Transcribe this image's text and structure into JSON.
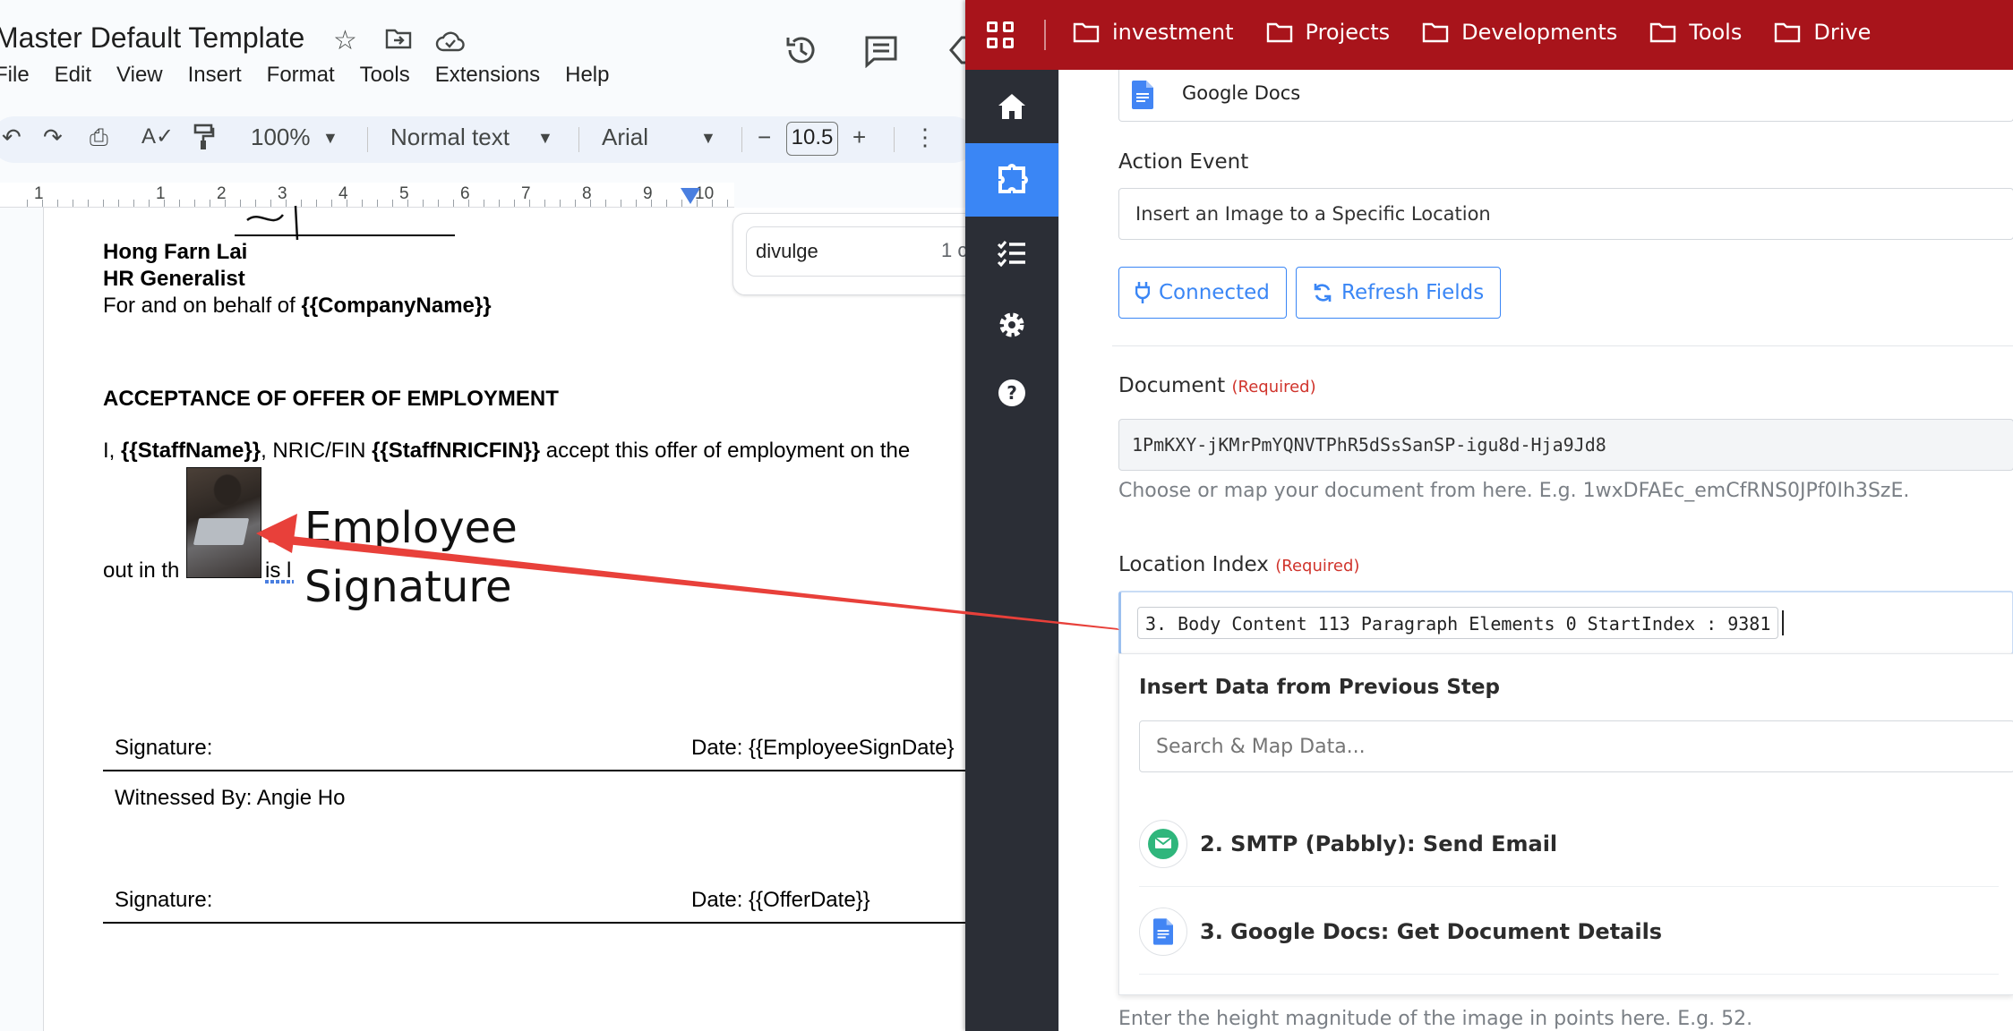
{
  "docs": {
    "title": "Master Default Template",
    "menu": [
      "File",
      "Edit",
      "View",
      "Insert",
      "Format",
      "Tools",
      "Extensions",
      "Help"
    ],
    "toolbar": {
      "zoom": "100%",
      "style": "Normal text",
      "font": "Arial",
      "font_size": "10.5"
    },
    "ruler_labels": [
      "1",
      "1",
      "2",
      "3",
      "4",
      "5",
      "6",
      "7",
      "8",
      "9",
      "10"
    ],
    "comment_text": "divulge",
    "comment_count": "1 c",
    "body": {
      "signer_name": "Hong Farn Lai",
      "signer_role": "HR Generalist",
      "behalf_prefix": "For and on behalf of ",
      "company_placeholder": "{{CompanyName}}",
      "acceptance_heading": "ACCEPTANCE OF OFFER OF EMPLOYMENT",
      "accept_i": "I, ",
      "staff_name": "{{StaffName}}",
      "accept_nric": ", NRIC/FIN ",
      "staff_nric": "{{StaffNRICFIN}}",
      "accept_rest": " accept this offer of employment on the",
      "out_in_th": "out in th",
      "is_l": "is l",
      "employee_sig_line1": "Employee",
      "employee_sig_line2": "Signature",
      "sig_label_1": "Signature:",
      "date_label_1": "Date: {{EmployeeSignDate}",
      "witnessed_by": "Witnessed By: Angie Ho",
      "sig_label_2": "Signature:",
      "date_label_2": "Date: {{OfferDate}}"
    }
  },
  "pabbly": {
    "folders": [
      "investment",
      "Projects",
      "Developments",
      "Tools",
      "Drive"
    ],
    "sidebar_icons": [
      "home-icon",
      "integration-icon",
      "tasks-icon",
      "settings-icon",
      "help-icon"
    ],
    "app_name": "Google Docs",
    "action_event_label": "Action Event",
    "action_event_value": "Insert an Image to a Specific Location",
    "connected_label": "Connected",
    "refresh_label": "Refresh Fields",
    "document_label": "Document",
    "required_tag": "(Required)",
    "document_value": "1PmKXY-jKMrPmYQNVTPhR5dSsSanSP-igu8d-Hja9Jd8",
    "document_hint": "Choose or map your document from here. E.g. 1wxDFAEc_emCfRNS0JPf0Ih3SzE.",
    "location_label": "Location Index",
    "location_value": "3. Body Content 113 Paragraph Elements 0 StartIndex : 9381",
    "insert_data_title": "Insert Data from Previous Step",
    "search_placeholder": "Search & Map Data...",
    "steps": [
      {
        "label": "2. SMTP (Pabbly): Send Email",
        "icon": "smtp-icon"
      },
      {
        "label": "3. Google Docs: Get Document Details",
        "icon": "google-docs-icon"
      }
    ],
    "height_hint": "Enter the height magnitude of the image in points here. E.g. 52.",
    "colors": {
      "topbar": "#a8141b",
      "sidebar": "#2b2e36",
      "accent": "#3a86f5",
      "arrow": "#e8403a"
    }
  }
}
